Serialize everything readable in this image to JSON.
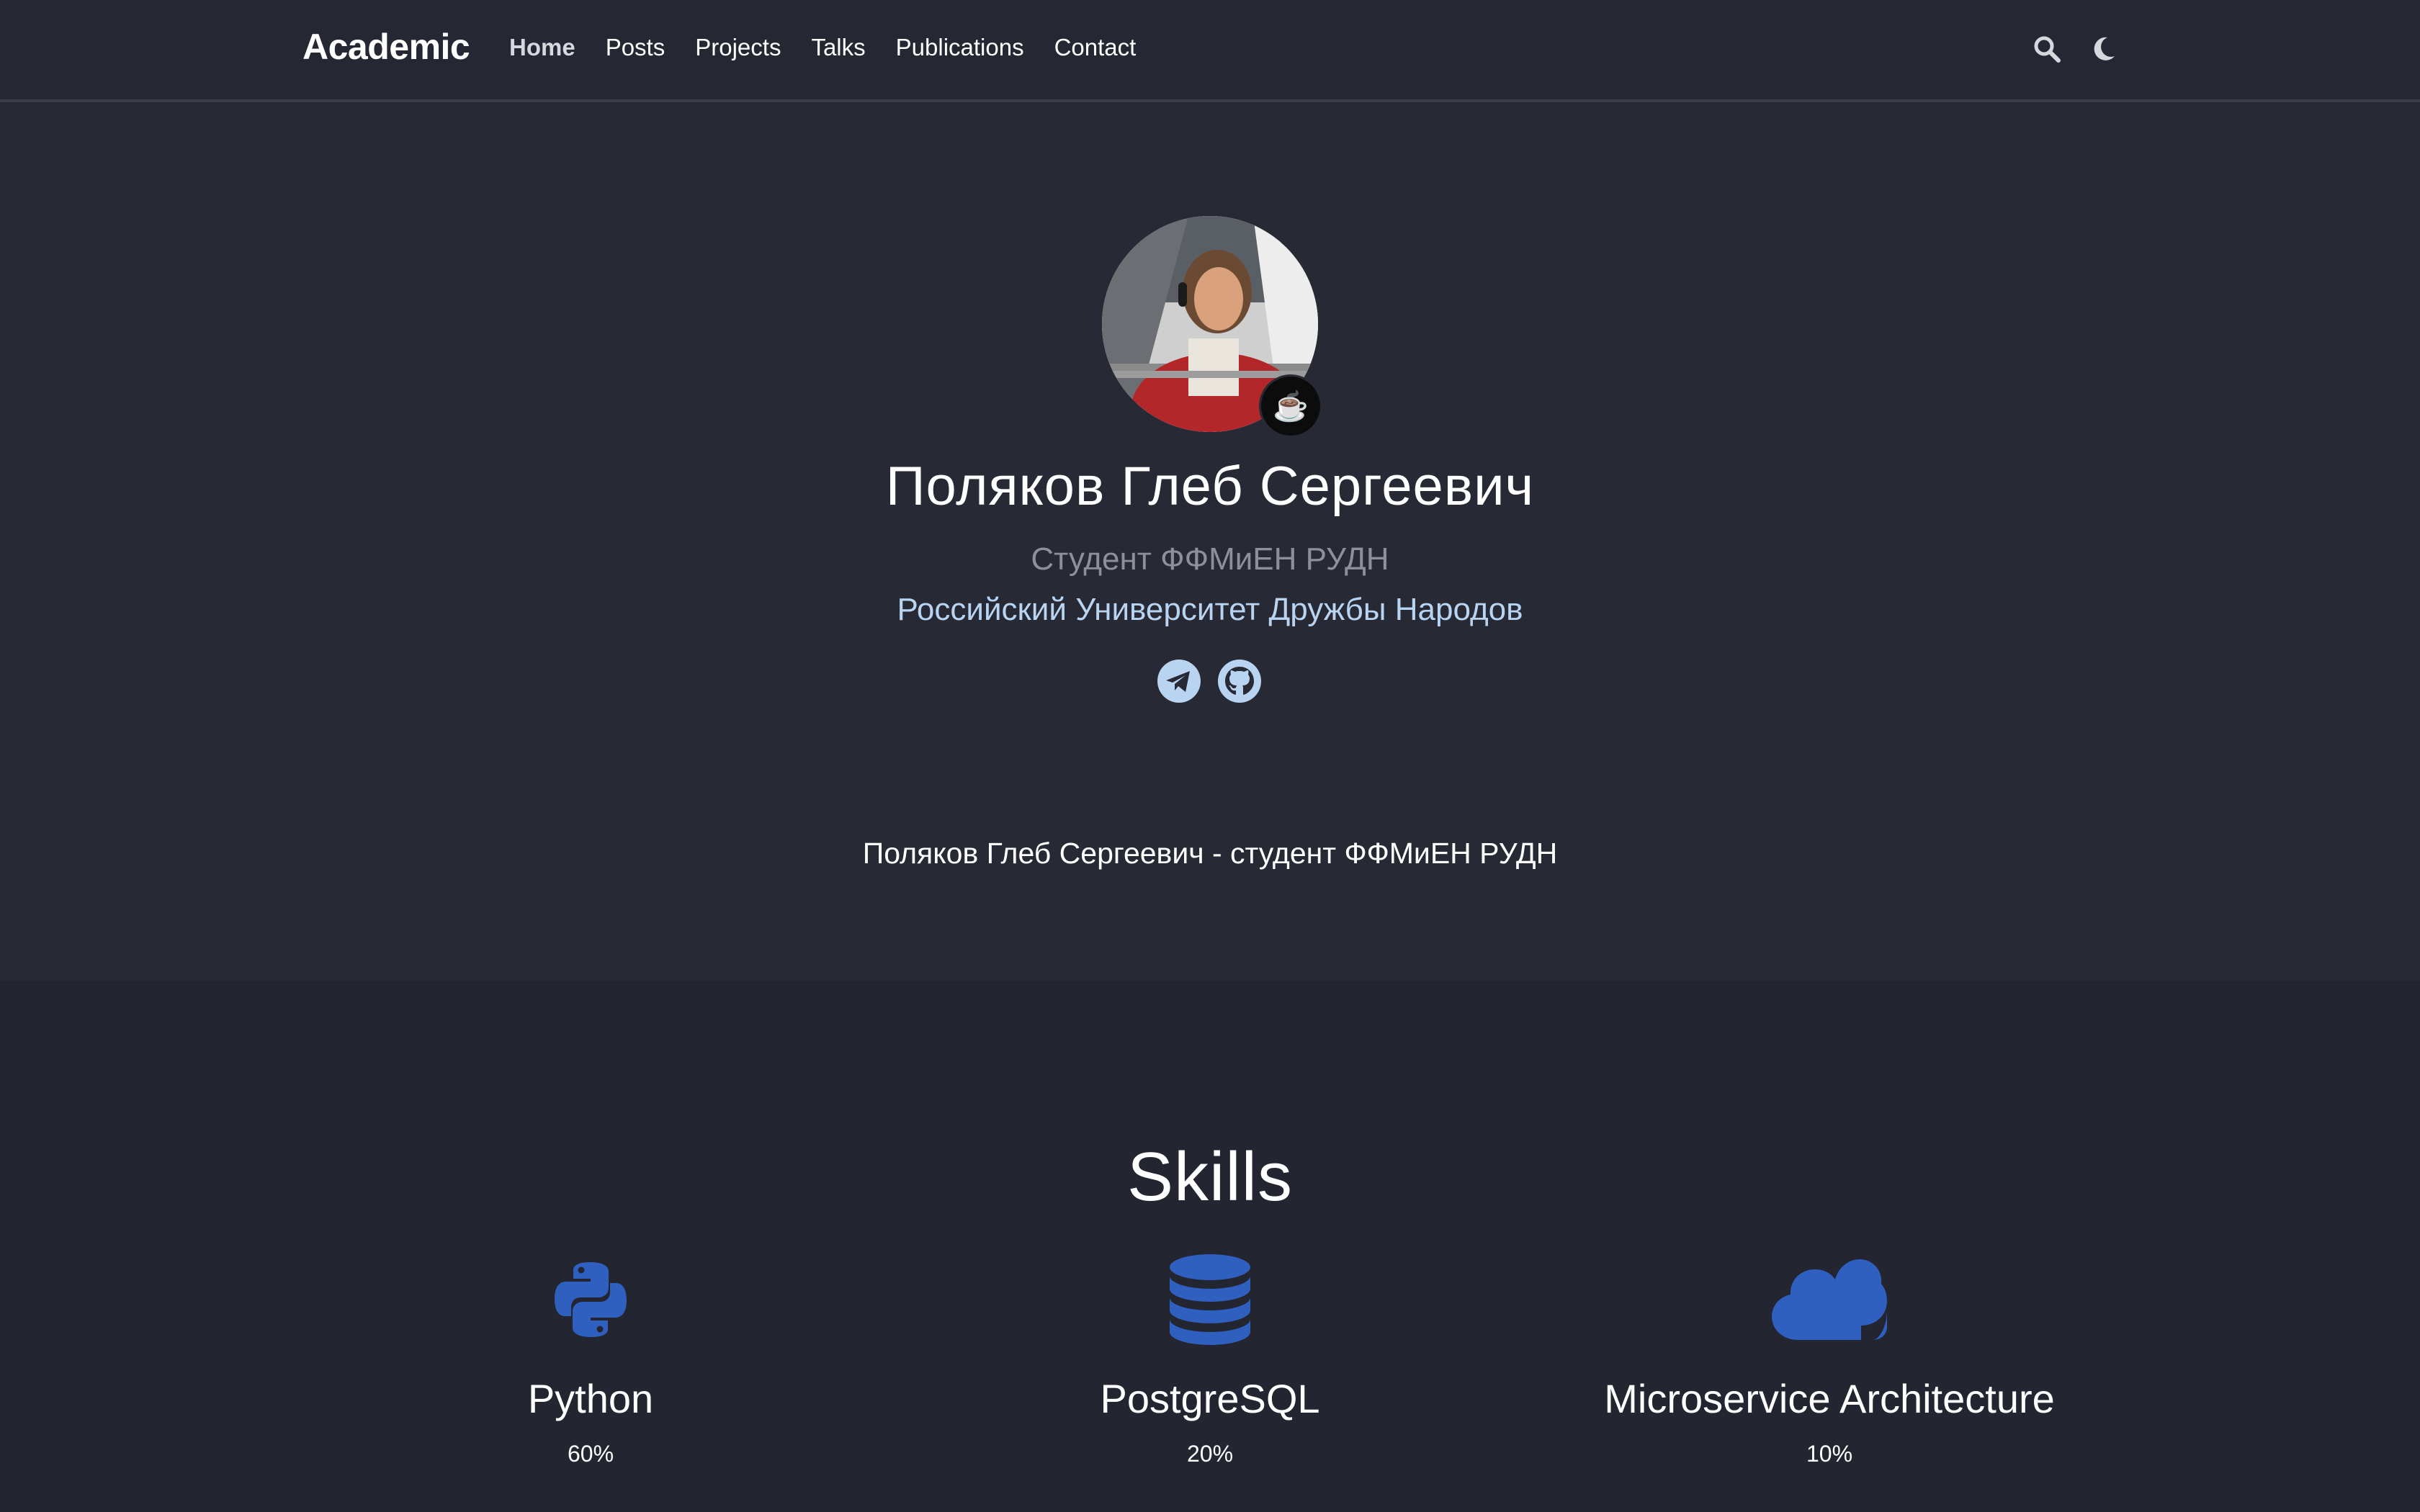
{
  "nav": {
    "brand": "Academic",
    "links": [
      {
        "label": "Home",
        "active": true
      },
      {
        "label": "Posts"
      },
      {
        "label": "Projects"
      },
      {
        "label": "Talks"
      },
      {
        "label": "Publications"
      },
      {
        "label": "Contact"
      }
    ],
    "icons": [
      "search-icon",
      "moon-icon"
    ]
  },
  "profile": {
    "status_emoji": "☕",
    "name": "Поляков Глеб Сергеевич",
    "role": "Студент ФФМиЕН РУДН",
    "organization": "Российский Университет Дружбы Народов",
    "socials": [
      "telegram-icon",
      "github-icon"
    ],
    "bio": "Поляков Глеб Сергеевич - студент ФФМиЕН РУДН"
  },
  "skills": {
    "title": "Skills",
    "items": [
      {
        "name": "Python",
        "level": "60%",
        "icon": "python-icon"
      },
      {
        "name": "PostgreSQL",
        "level": "20%",
        "icon": "database-icon"
      },
      {
        "name": "Microservice Architecture",
        "level": "10%",
        "icon": "cloud-icon"
      }
    ]
  },
  "colors": {
    "background": "#272935",
    "skills_background": "#232530",
    "accent": "#2f5fbf",
    "link": "#b9d4f1",
    "muted": "#8d9099"
  }
}
